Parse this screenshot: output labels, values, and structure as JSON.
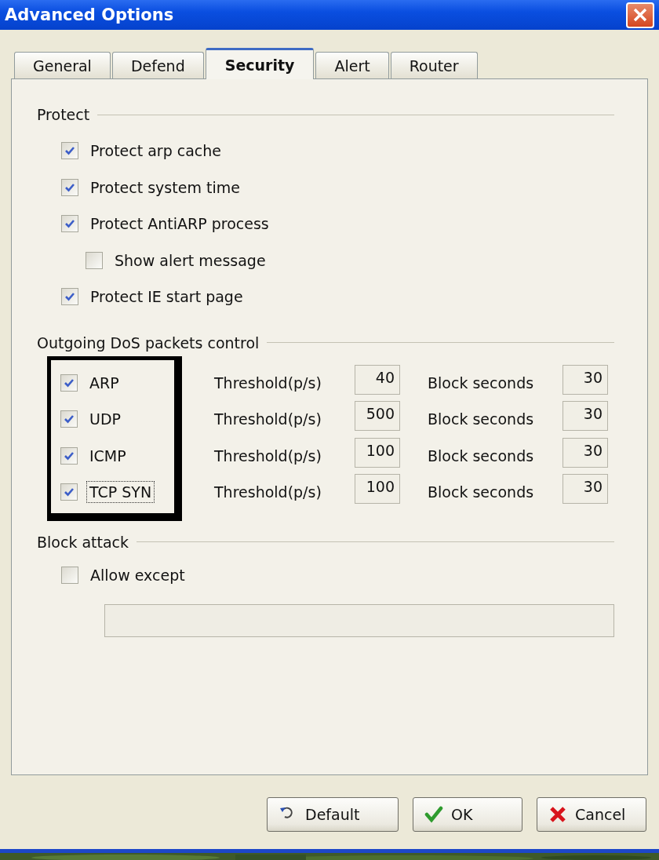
{
  "window": {
    "title": "Advanced Options"
  },
  "tabs": [
    {
      "label": "General",
      "selected": false
    },
    {
      "label": "Defend",
      "selected": false
    },
    {
      "label": "Security",
      "selected": true
    },
    {
      "label": "Alert",
      "selected": false
    },
    {
      "label": "Router",
      "selected": false
    }
  ],
  "protect": {
    "title": "Protect",
    "options": [
      {
        "label": "Protect arp cache",
        "checked": true
      },
      {
        "label": "Protect system time",
        "checked": true
      },
      {
        "label": "Protect AntiARP process",
        "checked": true,
        "children": [
          {
            "label": "Show alert message",
            "checked": false
          }
        ]
      },
      {
        "label": "Protect IE start page",
        "checked": true
      }
    ]
  },
  "dos_control": {
    "title": "Outgoing DoS packets control",
    "highlighted": true,
    "rows": [
      {
        "label": "ARP",
        "checked": true,
        "focused": false,
        "threshold_label": "Threshold(p/s)",
        "threshold": "40",
        "block_label": "Block seconds",
        "block_seconds": "30"
      },
      {
        "label": "UDP",
        "checked": true,
        "focused": false,
        "threshold_label": "Threshold(p/s)",
        "threshold": "500",
        "block_label": "Block seconds",
        "block_seconds": "30"
      },
      {
        "label": "ICMP",
        "checked": true,
        "focused": false,
        "threshold_label": "Threshold(p/s)",
        "threshold": "100",
        "block_label": "Block seconds",
        "block_seconds": "30"
      },
      {
        "label": "TCP SYN",
        "checked": true,
        "focused": true,
        "threshold_label": "Threshold(p/s)",
        "threshold": "100",
        "block_label": "Block seconds",
        "block_seconds": "30"
      }
    ]
  },
  "block_attack": {
    "title": "Block attack",
    "allow_except": {
      "label": "Allow except",
      "checked": false
    },
    "except_field": {
      "disabled": true
    }
  },
  "buttons": [
    {
      "label": "Default",
      "kind": "default"
    },
    {
      "label": "OK",
      "kind": "ok"
    },
    {
      "label": "Cancel",
      "kind": "cancel"
    }
  ]
}
